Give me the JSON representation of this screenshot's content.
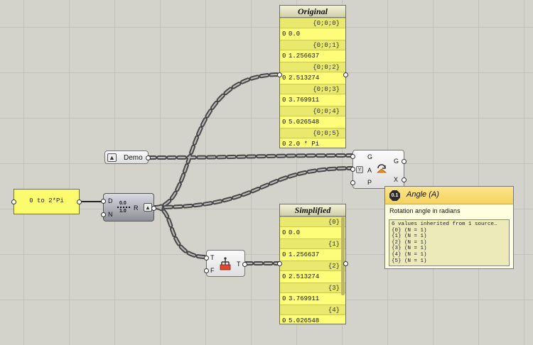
{
  "panels": {
    "original": {
      "title": "Original",
      "rows": [
        {
          "path": "{0;0;0}",
          "index": "0",
          "value": "0.0"
        },
        {
          "path": "{0;0;1}",
          "index": "0",
          "value": "1.256637"
        },
        {
          "path": "{0;0;2}",
          "index": "0",
          "value": "2.513274"
        },
        {
          "path": "{0;0;3}",
          "index": "0",
          "value": "3.769911"
        },
        {
          "path": "{0;0;4}",
          "index": "0",
          "value": "5.026548"
        },
        {
          "path": "{0;0;5}",
          "index": "0",
          "value": "2.0 * Pi"
        }
      ]
    },
    "simplified": {
      "title": "Simplified",
      "rows": [
        {
          "path": "{0}",
          "index": "0",
          "value": "0.0"
        },
        {
          "path": "{1}",
          "index": "0",
          "value": "1.256637"
        },
        {
          "path": "{2}",
          "index": "0",
          "value": "2.513274"
        },
        {
          "path": "{3}",
          "index": "0",
          "value": "3.769911"
        },
        {
          "path": "{4}",
          "index": "0",
          "value": "5.026548"
        }
      ]
    }
  },
  "range_panel": {
    "text": "0 to 2*Pi"
  },
  "demo_param": {
    "label": "Demo"
  },
  "range_component": {
    "inputs": [
      "D",
      "N"
    ],
    "output": "R",
    "icon_text": [
      "0.0",
      "1.0"
    ]
  },
  "rotate_component": {
    "inputs": [
      "G",
      "A",
      "P"
    ],
    "outputs": [
      "G",
      "X"
    ]
  },
  "simplify_component": {
    "inputs": [
      "T",
      "F"
    ],
    "output": "T"
  },
  "tooltip": {
    "badge": "0.1",
    "title": "Angle (A)",
    "description": "Rotation angle in radians",
    "details": [
      "6 values inherited from 1 source…",
      "{0} (N = 1)",
      "{1} (N = 1)",
      "{2} (N = 1)",
      "{3} (N = 1)",
      "{4} (N = 1)",
      "{5} (N = 1)"
    ]
  },
  "colors": {
    "canvas": "#d4d3cb",
    "panel_yellow": "#fdfd7a",
    "wire": "#555555",
    "tooltip_header": "#f5d25c",
    "accent_orange": "#f08c1e"
  }
}
